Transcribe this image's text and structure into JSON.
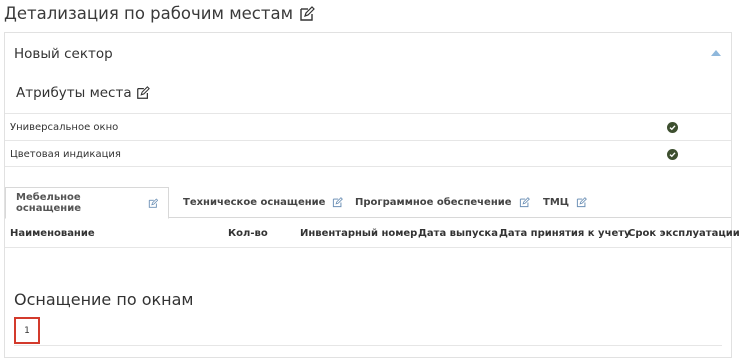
{
  "page_title": "Детализация по рабочим местам",
  "sector": {
    "title": "Новый сектор"
  },
  "attributes": {
    "title": "Атрибуты места",
    "rows": [
      {
        "label": "Универсальное окно"
      },
      {
        "label": "Цветовая индикация"
      }
    ]
  },
  "tabs": [
    {
      "label": "Мебельное оснащение"
    },
    {
      "label": "Техническое оснащение"
    },
    {
      "label": "Программное обеспечение"
    },
    {
      "label": "ТМЦ"
    }
  ],
  "table": {
    "headers": [
      "Наименование",
      "Кол-во",
      "Инвентарный номер",
      "Дата выпуска",
      "Дата принятия к учету",
      "Срок эксплуатации"
    ]
  },
  "windows": {
    "title": "Оснащение по окнам",
    "items": [
      "1"
    ]
  },
  "colors": {
    "check": "#3d4f2f",
    "accent_arrow": "#8fb8dc",
    "highlight_border": "#d33a2c"
  },
  "icons": {
    "edit": "edit-icon",
    "check": "check-circle-icon",
    "collapse": "chevron-up-icon"
  }
}
